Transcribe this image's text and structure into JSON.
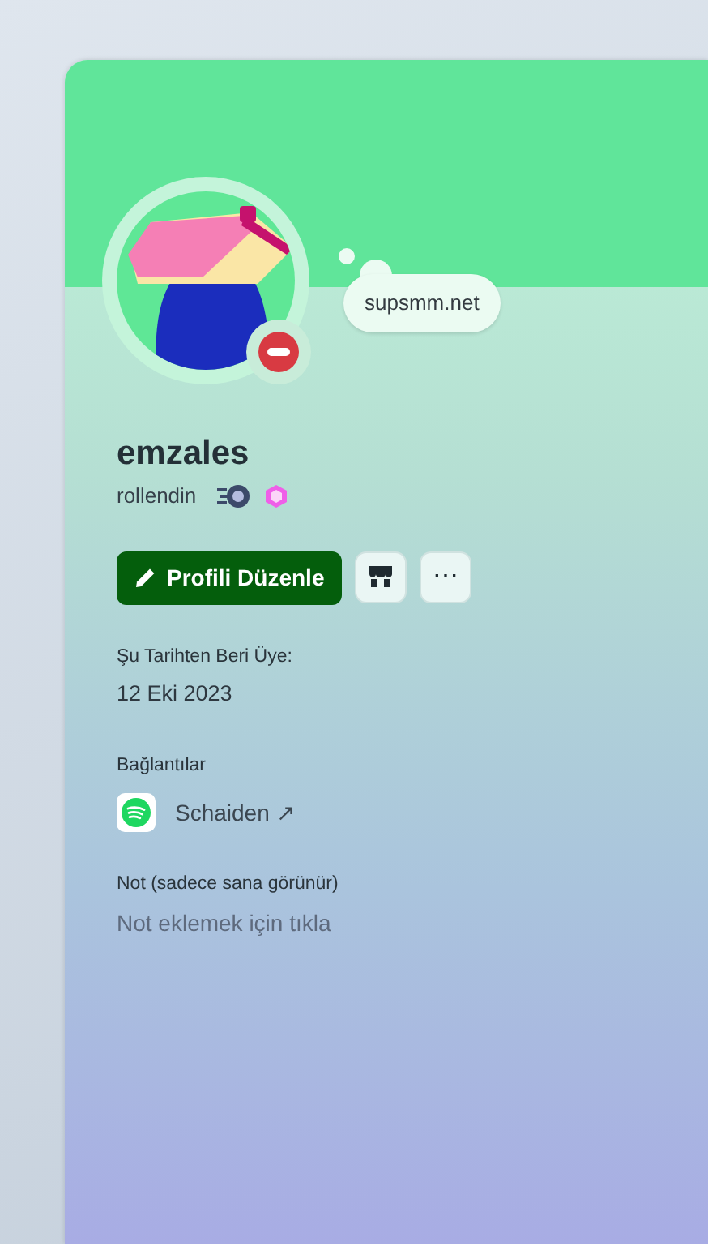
{
  "profile": {
    "status_text": "supsmm.net",
    "do_not_disturb": true,
    "display_name": "emzales",
    "username": "rollendin"
  },
  "actions": {
    "edit_label": "Profili Düzenle",
    "more_label": "⋯"
  },
  "member_since": {
    "label": "Şu Tarihten Beri Üye:",
    "value": "12 Eki 2023"
  },
  "connections": {
    "label": "Bağlantılar",
    "items": [
      {
        "kind": "spotify",
        "name": "Schaiden",
        "arrow": "↗"
      }
    ]
  },
  "note": {
    "label": "Not (sadece sana görünür)",
    "placeholder": "Not eklemek için tıkla"
  }
}
